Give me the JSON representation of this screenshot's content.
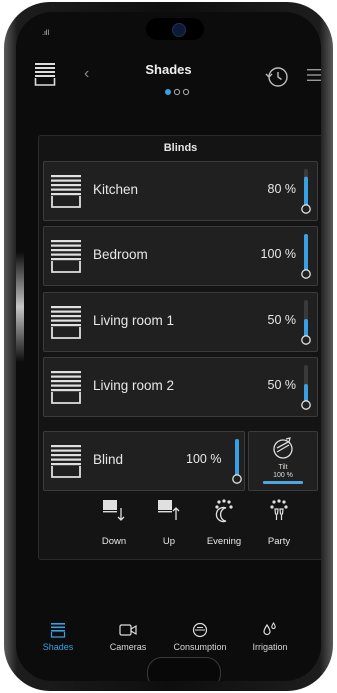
{
  "status": {
    "signal": ".ıll"
  },
  "header": {
    "title": "Shades",
    "page_dots": 3,
    "active_dot": 0
  },
  "panel": {
    "title": "Blinds",
    "rows": [
      {
        "label": "Kitchen",
        "value": "80 %",
        "level": 0.8
      },
      {
        "label": "Bedroom",
        "value": "100 %",
        "level": 1.0
      },
      {
        "label": "Living room 1",
        "value": "50 %",
        "level": 0.5
      },
      {
        "label": "Living room 2",
        "value": "50 %",
        "level": 0.5
      }
    ],
    "blind": {
      "label": "Blind",
      "value": "100 %",
      "level": 1.0
    },
    "tilt": {
      "label": "Tilt",
      "value": "100 %",
      "level": 1.0
    },
    "scenes": [
      {
        "label": "Down",
        "icon": "blind-down-icon"
      },
      {
        "label": "Up",
        "icon": "blind-up-icon"
      },
      {
        "label": "Evening",
        "icon": "evening-scene-icon"
      },
      {
        "label": "Party",
        "icon": "party-scene-icon"
      }
    ]
  },
  "nav": {
    "items": [
      {
        "label": "Shades",
        "icon": "shades-icon",
        "active": true
      },
      {
        "label": "Cameras",
        "icon": "camera-icon",
        "active": false
      },
      {
        "label": "Consumption",
        "icon": "meter-icon",
        "active": false
      },
      {
        "label": "Irrigation",
        "icon": "water-drops-icon",
        "active": false
      }
    ]
  },
  "colors": {
    "accent": "#3aa0e4",
    "background": "#0c0c0c",
    "tile": "#202020"
  }
}
